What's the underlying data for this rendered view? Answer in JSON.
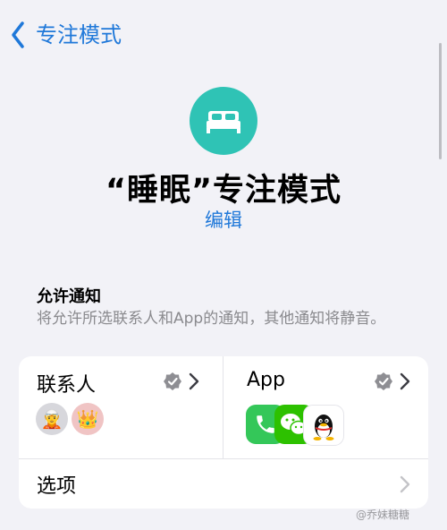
{
  "nav": {
    "back_label": "专注模式"
  },
  "header": {
    "title": "“睡眠”专注模式",
    "edit_label": "编辑",
    "icon": "bed-icon"
  },
  "allow_section": {
    "title": "允许通知",
    "description": "将允许所选联系人和App的通知，其他通知将静音。"
  },
  "people_cell": {
    "label": "联系人",
    "avatars": [
      "🧝",
      "👑"
    ]
  },
  "apps_cell": {
    "label": "App",
    "apps": [
      "phone-icon",
      "wechat-icon",
      "qq-icon"
    ]
  },
  "options": {
    "label": "选项"
  },
  "watermark": "@乔妹糖糖",
  "colors": {
    "accent": "#1f78d9",
    "icon_bg": "#2fc3b5",
    "background": "#f2f2f7"
  }
}
